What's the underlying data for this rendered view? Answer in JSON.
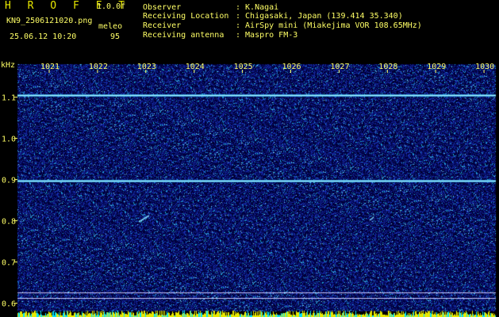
{
  "header": {
    "brand": "H R O F F T",
    "version": "1.0.0f",
    "filename": "KN9_2506121020.png",
    "datetime": "25.06.12 10:20",
    "meleo_label": "meleo",
    "count": "95",
    "observer_label": "Observer",
    "observer_value": ": K.Nagai",
    "location_label": "Receiving Location",
    "location_value": ": Chigasaki, Japan (139.414 35.340)",
    "receiver_label": "Receiver",
    "receiver_value": ": AirSpy mini (Miakejima VOR 108.65MHz)",
    "antenna_label": "Receiving antenna",
    "antenna_value": ": Maspro FM-3"
  },
  "chart_data": {
    "type": "heatmap",
    "ylabel": "kHz",
    "x_ticks": [
      "1021",
      "1022",
      "1023",
      "1024",
      "1025",
      "1026",
      "1027",
      "1028",
      "1029",
      "1030"
    ],
    "y_ticks": [
      "1.1",
      "1.0",
      "0.9",
      "0.8",
      "0.7",
      "0.6"
    ],
    "ylim": [
      0.58,
      1.18
    ],
    "carrier_lines_khz": [
      1.105,
      0.897
    ],
    "colors": {
      "background": "#000000",
      "noise_base": "#0a1a7a",
      "carrier": "#66ccff",
      "text": "#ffff66"
    }
  }
}
